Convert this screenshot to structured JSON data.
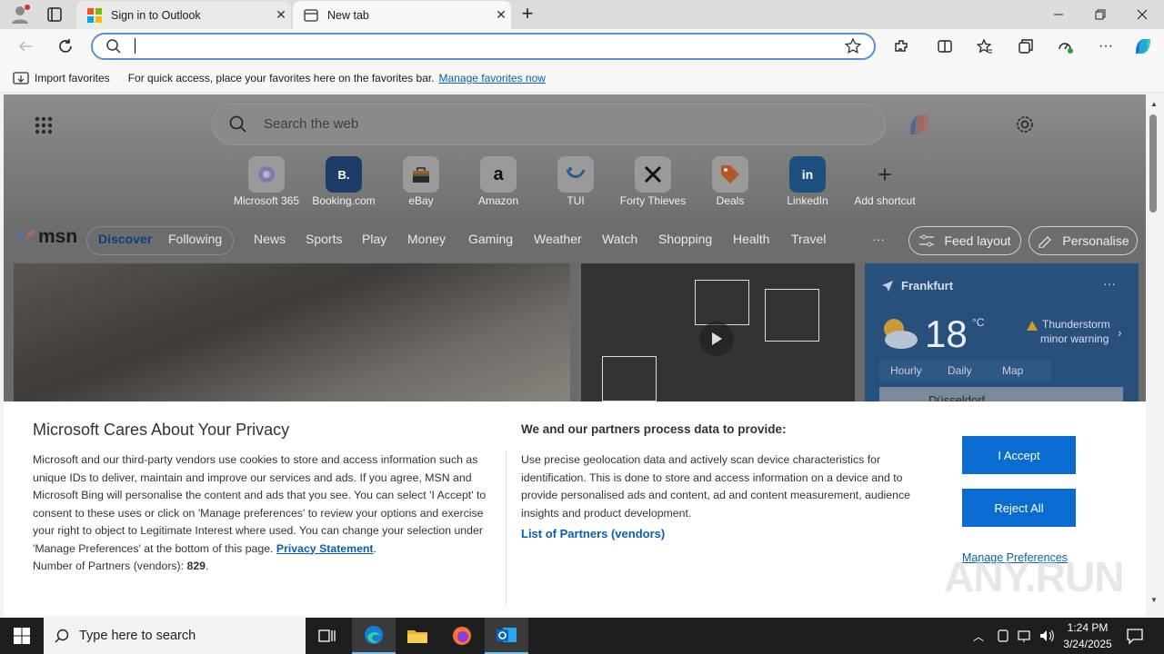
{
  "browser": {
    "tabs": [
      {
        "title": "Sign in to Outlook",
        "active": false
      },
      {
        "title": "New tab",
        "active": true
      }
    ],
    "address_value": "",
    "favorites_bar": {
      "import_label": "Import favorites",
      "hint": "For quick access, place your favorites here on the favorites bar.",
      "manage_link": "Manage favorites now"
    }
  },
  "newtab": {
    "search_placeholder": "Search the web",
    "shortcuts": [
      {
        "label": "Microsoft 365",
        "icon": "m365-icon"
      },
      {
        "label": "Booking.com",
        "icon": "booking-icon",
        "glyph": "B."
      },
      {
        "label": "eBay",
        "icon": "ebay-icon"
      },
      {
        "label": "Amazon",
        "icon": "amazon-icon",
        "glyph": "a"
      },
      {
        "label": "TUI",
        "icon": "tui-icon"
      },
      {
        "label": "Forty Thieves",
        "icon": "swords-icon"
      },
      {
        "label": "Deals",
        "icon": "tag-icon"
      },
      {
        "label": "LinkedIn",
        "icon": "linkedin-icon",
        "glyph": "in"
      },
      {
        "label": "Add shortcut",
        "icon": "plus-icon",
        "glyph": "+"
      }
    ],
    "msn": {
      "logo": "msn",
      "toggle": [
        "Discover",
        "Following"
      ],
      "nav": [
        "News",
        "Sports",
        "Play",
        "Money",
        "Gaming",
        "Weather",
        "Watch",
        "Shopping",
        "Health",
        "Travel"
      ],
      "more": "···",
      "feed_layout": "Feed layout",
      "personalise": "Personalise"
    },
    "weather": {
      "city": "Frankfurt",
      "temp": "18",
      "unit": "°C",
      "alert_line1": "Thunderstorm",
      "alert_line2": "minor warning",
      "tabs": [
        "Hourly",
        "Daily",
        "Map"
      ],
      "map_label": "Düsseldorf"
    }
  },
  "privacy": {
    "title": "Microsoft Cares About Your Privacy",
    "body": "Microsoft and our third-party vendors use cookies to store and access information such as unique IDs to deliver, maintain and improve our services and ads. If you agree, MSN and Microsoft Bing will personalise the content and ads that you see. You can select 'I Accept' to consent to these uses or click on 'Manage preferences' to review your options and exercise your right to object to Legitimate Interest where used.  You can change your selection under 'Manage Preferences' at the bottom of this page.",
    "privacy_link": "Privacy Statement",
    "partners_count_label": "Number of Partners (vendors):",
    "partners_count": "829",
    "right_heading": "We and our partners process data to provide:",
    "right_body": "Use precise geolocation data and actively scan device characteristics for identification. This is done to store and access information on a device and to provide personalised ads and content, ad and content measurement, audience insights and product development.",
    "partners_link": "List of Partners (vendors)",
    "accept": "I Accept",
    "reject": "Reject All",
    "manage": "Manage Preferences"
  },
  "watermark": "ANY.RUN",
  "taskbar": {
    "search_placeholder": "Type here to search",
    "time": "1:24 PM",
    "date": "3/24/2025"
  },
  "colors": {
    "accent": "#0a6bd1",
    "link": "#0b5db3",
    "taskbar": "#1e1e1e"
  }
}
